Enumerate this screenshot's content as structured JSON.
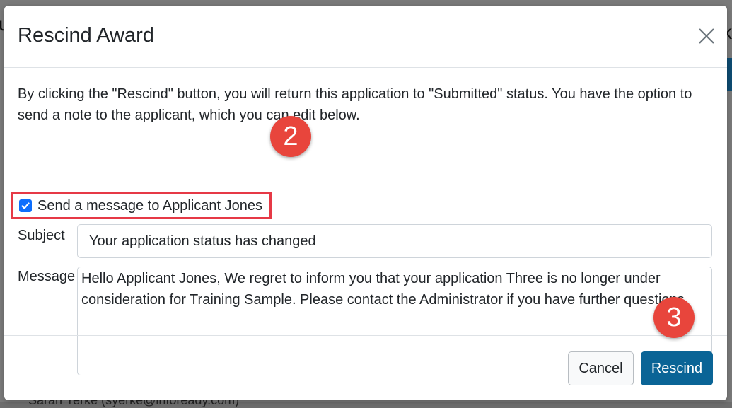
{
  "background": {
    "left_fragment": "u",
    "right_fragment": "k",
    "bottom_fragment": "Sarah Yerke (syerke@infoready.com)"
  },
  "modal": {
    "title": "Rescind Award",
    "close_icon": "close-icon",
    "intro_text": "By clicking the \"Rescind\" button, you will return this application to \"Submitted\" status. You have the option to send a note to the applicant, which you can edit below.",
    "send_message": {
      "checked": true,
      "label": "Send a message to Applicant Jones"
    },
    "subject": {
      "label": "Subject",
      "value": "Your application status has changed"
    },
    "message": {
      "label": "Message",
      "value": "Hello Applicant Jones, We regret to inform you that your application Three is no longer under consideration for Training Sample. Please contact the Administrator if you have further questions."
    },
    "buttons": {
      "cancel": "Cancel",
      "rescind": "Rescind"
    }
  },
  "annotations": {
    "step_2": "2",
    "step_3": "3"
  },
  "colors": {
    "primary_button": "#0a6496",
    "annotation_badge": "#e8453c",
    "highlight_border": "#e63946",
    "checkbox": "#0d6efd"
  }
}
